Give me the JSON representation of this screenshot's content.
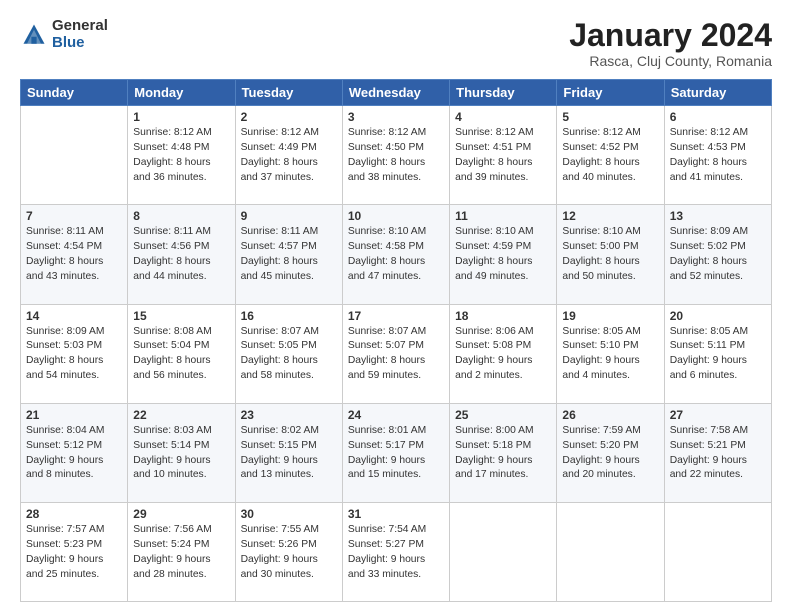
{
  "header": {
    "logo_general": "General",
    "logo_blue": "Blue",
    "title": "January 2024",
    "location": "Rasca, Cluj County, Romania"
  },
  "days_of_week": [
    "Sunday",
    "Monday",
    "Tuesday",
    "Wednesday",
    "Thursday",
    "Friday",
    "Saturday"
  ],
  "weeks": [
    [
      {
        "day": "",
        "info": ""
      },
      {
        "day": "1",
        "info": "Sunrise: 8:12 AM\nSunset: 4:48 PM\nDaylight: 8 hours\nand 36 minutes."
      },
      {
        "day": "2",
        "info": "Sunrise: 8:12 AM\nSunset: 4:49 PM\nDaylight: 8 hours\nand 37 minutes."
      },
      {
        "day": "3",
        "info": "Sunrise: 8:12 AM\nSunset: 4:50 PM\nDaylight: 8 hours\nand 38 minutes."
      },
      {
        "day": "4",
        "info": "Sunrise: 8:12 AM\nSunset: 4:51 PM\nDaylight: 8 hours\nand 39 minutes."
      },
      {
        "day": "5",
        "info": "Sunrise: 8:12 AM\nSunset: 4:52 PM\nDaylight: 8 hours\nand 40 minutes."
      },
      {
        "day": "6",
        "info": "Sunrise: 8:12 AM\nSunset: 4:53 PM\nDaylight: 8 hours\nand 41 minutes."
      }
    ],
    [
      {
        "day": "7",
        "info": "Sunrise: 8:11 AM\nSunset: 4:54 PM\nDaylight: 8 hours\nand 43 minutes."
      },
      {
        "day": "8",
        "info": "Sunrise: 8:11 AM\nSunset: 4:56 PM\nDaylight: 8 hours\nand 44 minutes."
      },
      {
        "day": "9",
        "info": "Sunrise: 8:11 AM\nSunset: 4:57 PM\nDaylight: 8 hours\nand 45 minutes."
      },
      {
        "day": "10",
        "info": "Sunrise: 8:10 AM\nSunset: 4:58 PM\nDaylight: 8 hours\nand 47 minutes."
      },
      {
        "day": "11",
        "info": "Sunrise: 8:10 AM\nSunset: 4:59 PM\nDaylight: 8 hours\nand 49 minutes."
      },
      {
        "day": "12",
        "info": "Sunrise: 8:10 AM\nSunset: 5:00 PM\nDaylight: 8 hours\nand 50 minutes."
      },
      {
        "day": "13",
        "info": "Sunrise: 8:09 AM\nSunset: 5:02 PM\nDaylight: 8 hours\nand 52 minutes."
      }
    ],
    [
      {
        "day": "14",
        "info": "Sunrise: 8:09 AM\nSunset: 5:03 PM\nDaylight: 8 hours\nand 54 minutes."
      },
      {
        "day": "15",
        "info": "Sunrise: 8:08 AM\nSunset: 5:04 PM\nDaylight: 8 hours\nand 56 minutes."
      },
      {
        "day": "16",
        "info": "Sunrise: 8:07 AM\nSunset: 5:05 PM\nDaylight: 8 hours\nand 58 minutes."
      },
      {
        "day": "17",
        "info": "Sunrise: 8:07 AM\nSunset: 5:07 PM\nDaylight: 8 hours\nand 59 minutes."
      },
      {
        "day": "18",
        "info": "Sunrise: 8:06 AM\nSunset: 5:08 PM\nDaylight: 9 hours\nand 2 minutes."
      },
      {
        "day": "19",
        "info": "Sunrise: 8:05 AM\nSunset: 5:10 PM\nDaylight: 9 hours\nand 4 minutes."
      },
      {
        "day": "20",
        "info": "Sunrise: 8:05 AM\nSunset: 5:11 PM\nDaylight: 9 hours\nand 6 minutes."
      }
    ],
    [
      {
        "day": "21",
        "info": "Sunrise: 8:04 AM\nSunset: 5:12 PM\nDaylight: 9 hours\nand 8 minutes."
      },
      {
        "day": "22",
        "info": "Sunrise: 8:03 AM\nSunset: 5:14 PM\nDaylight: 9 hours\nand 10 minutes."
      },
      {
        "day": "23",
        "info": "Sunrise: 8:02 AM\nSunset: 5:15 PM\nDaylight: 9 hours\nand 13 minutes."
      },
      {
        "day": "24",
        "info": "Sunrise: 8:01 AM\nSunset: 5:17 PM\nDaylight: 9 hours\nand 15 minutes."
      },
      {
        "day": "25",
        "info": "Sunrise: 8:00 AM\nSunset: 5:18 PM\nDaylight: 9 hours\nand 17 minutes."
      },
      {
        "day": "26",
        "info": "Sunrise: 7:59 AM\nSunset: 5:20 PM\nDaylight: 9 hours\nand 20 minutes."
      },
      {
        "day": "27",
        "info": "Sunrise: 7:58 AM\nSunset: 5:21 PM\nDaylight: 9 hours\nand 22 minutes."
      }
    ],
    [
      {
        "day": "28",
        "info": "Sunrise: 7:57 AM\nSunset: 5:23 PM\nDaylight: 9 hours\nand 25 minutes."
      },
      {
        "day": "29",
        "info": "Sunrise: 7:56 AM\nSunset: 5:24 PM\nDaylight: 9 hours\nand 28 minutes."
      },
      {
        "day": "30",
        "info": "Sunrise: 7:55 AM\nSunset: 5:26 PM\nDaylight: 9 hours\nand 30 minutes."
      },
      {
        "day": "31",
        "info": "Sunrise: 7:54 AM\nSunset: 5:27 PM\nDaylight: 9 hours\nand 33 minutes."
      },
      {
        "day": "",
        "info": ""
      },
      {
        "day": "",
        "info": ""
      },
      {
        "day": "",
        "info": ""
      }
    ]
  ]
}
